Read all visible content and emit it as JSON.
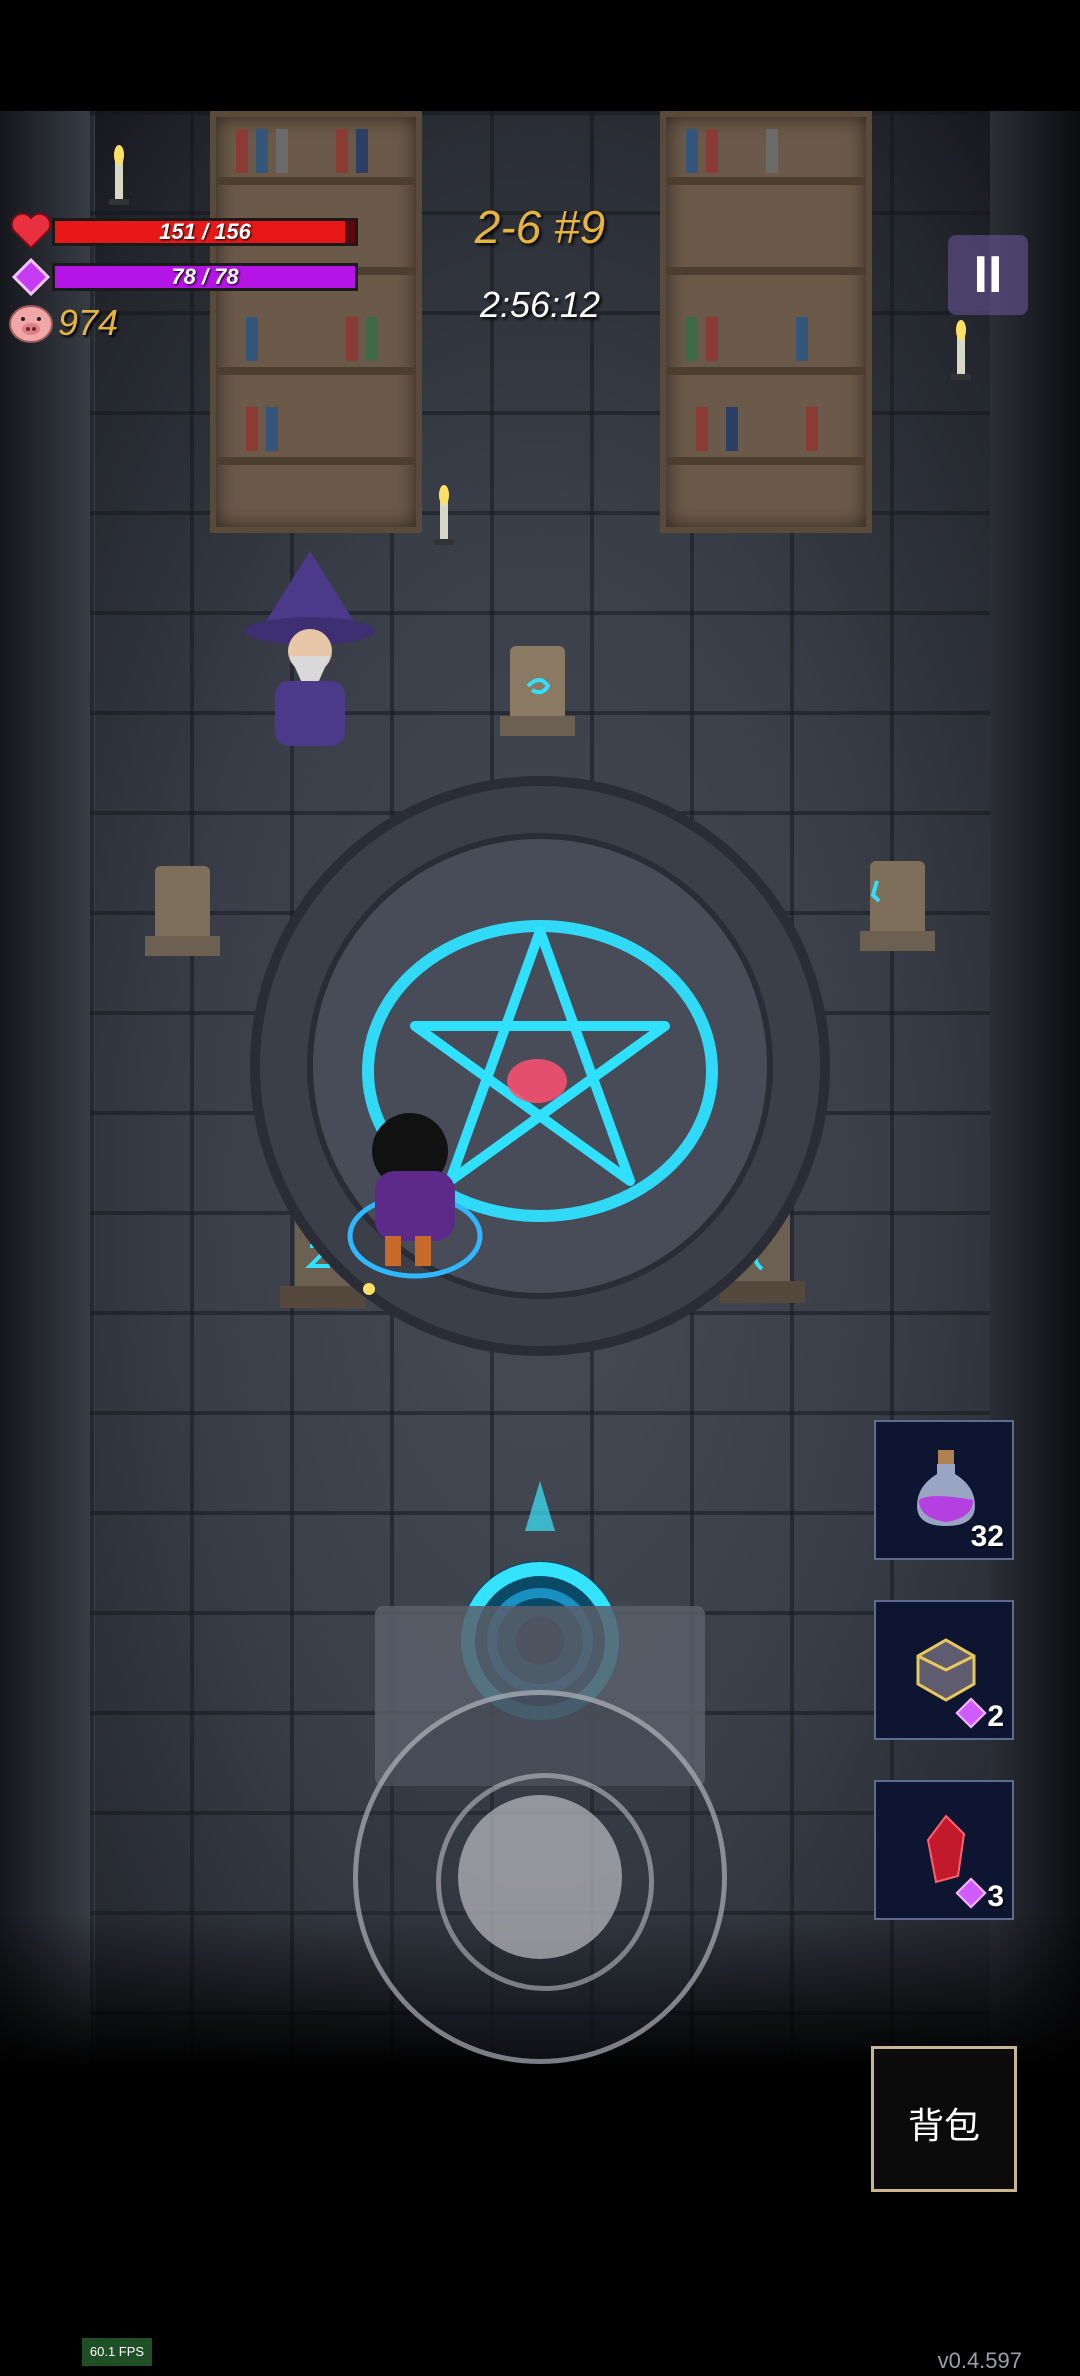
{
  "hud": {
    "hp_text": "151 / 156",
    "hp_fraction": 0.968,
    "mp_text": "78 / 78",
    "mp_fraction": 1.0,
    "gold": "974",
    "level": "2-6 #9",
    "timer": "2:56:12",
    "pause_label": "II"
  },
  "items": [
    {
      "icon": "potion-icon",
      "count": "32",
      "cost_gem": false
    },
    {
      "icon": "crystal-orb-icon",
      "count": "2",
      "cost_gem": true
    },
    {
      "icon": "red-crystal-icon",
      "count": "3",
      "cost_gem": true
    }
  ],
  "backpack_label": "背包",
  "fps": "60.1 FPS",
  "version": "v0.4.597",
  "colors": {
    "hp": "#e81818",
    "mp": "#b414e6",
    "gold_text": "#e6b43c",
    "rune_glow": "#2fe0ff"
  }
}
